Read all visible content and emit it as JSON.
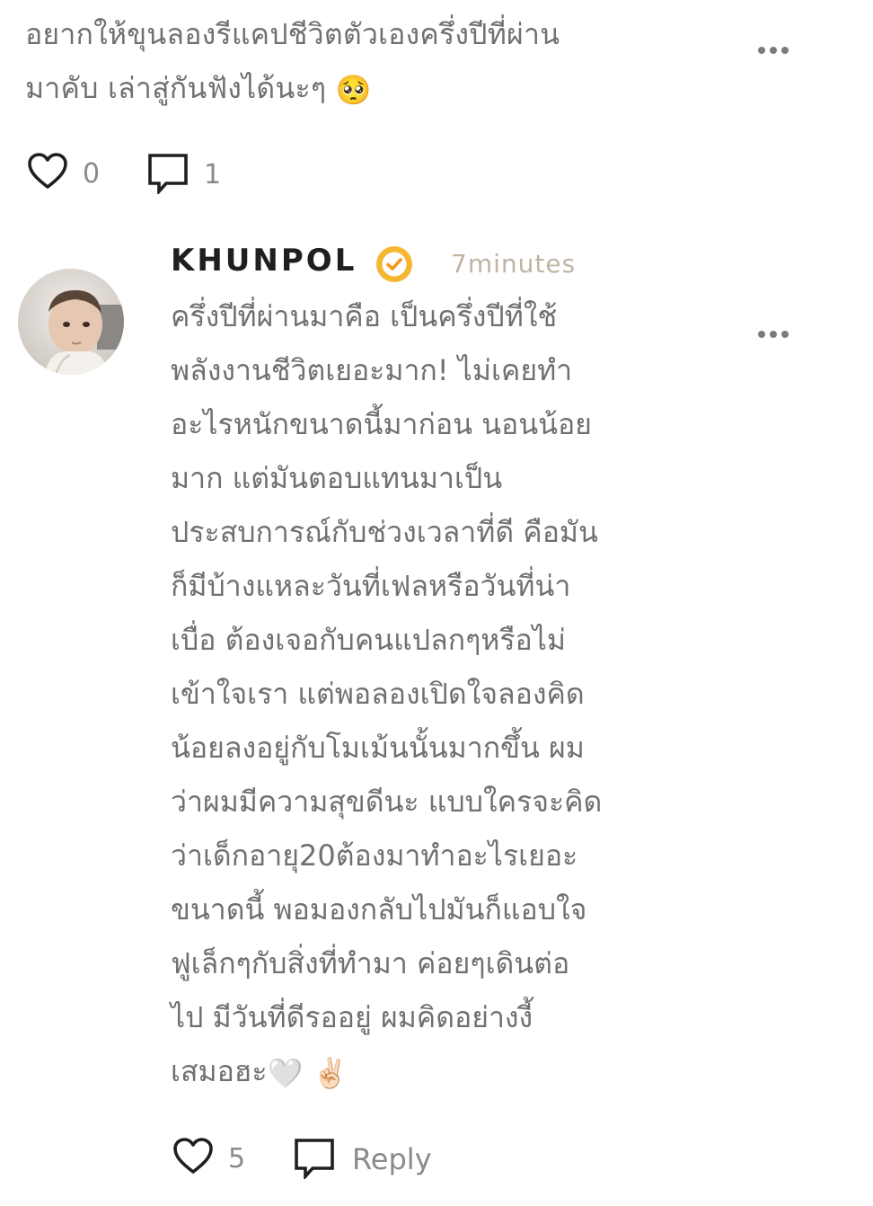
{
  "previous_comment": {
    "lines": [
      "อยากให้ขุนลองรีแคปชีวิตตัวเองครึ่งปีที่ผ่าน",
      "มาคับ เล่าสู่กันฟังได้นะๆ"
    ],
    "emoji": "🥺",
    "like_count": "0",
    "reply_count": "1"
  },
  "reply": {
    "username": "KHUNPOL",
    "timestamp": "7minutes",
    "lines": [
      "ครึ่งปีที่ผ่านมาคือ เป็นครึ่งปีที่ใช้",
      "พลังงานชีวิตเยอะมาก! ไม่เคยทำ",
      "อะไรหนักขนาดนี้มาก่อน นอนน้อย",
      "มาก แต่มันตอบแทนมาเป็น",
      "ประสบการณ์กับช่วงเวลาที่ดี คือมัน",
      "ก็มีบ้างแหละวันที่เฟลหรือวันที่น่า",
      "เบื่อ ต้องเจอกับคนแปลกๆหรือไม่",
      "เข้าใจเรา แต่พอลองเปิดใจลองคิด",
      "น้อยลงอยู่กับโมเม้นนั้นมากขึ้น ผม",
      "ว่าผมมีความสุขดีนะ แบบใครจะคิด",
      "ว่าเด็กอายุ20ต้องมาทำอะไรเยอะ",
      "ขนาดนี้ พอมองกลับไปมันก็แอบใจ",
      "ฟูเล็กๆกับสิ่งที่ทำมา ค่อยๆเดินต่อ",
      "ไป มีวันที่ดีรออยู่ ผมคิดอย่างงี้",
      "เสมอฮะ"
    ],
    "trailing_emoji": "🤍 ✌🏻",
    "like_count": "5",
    "reply_label": "Reply"
  },
  "colors": {
    "text": "#707070",
    "username": "#1f1f1f",
    "timestamp": "#c2b3a3",
    "verified_badge": "#f5b731",
    "icon": "#1f1f1f"
  }
}
